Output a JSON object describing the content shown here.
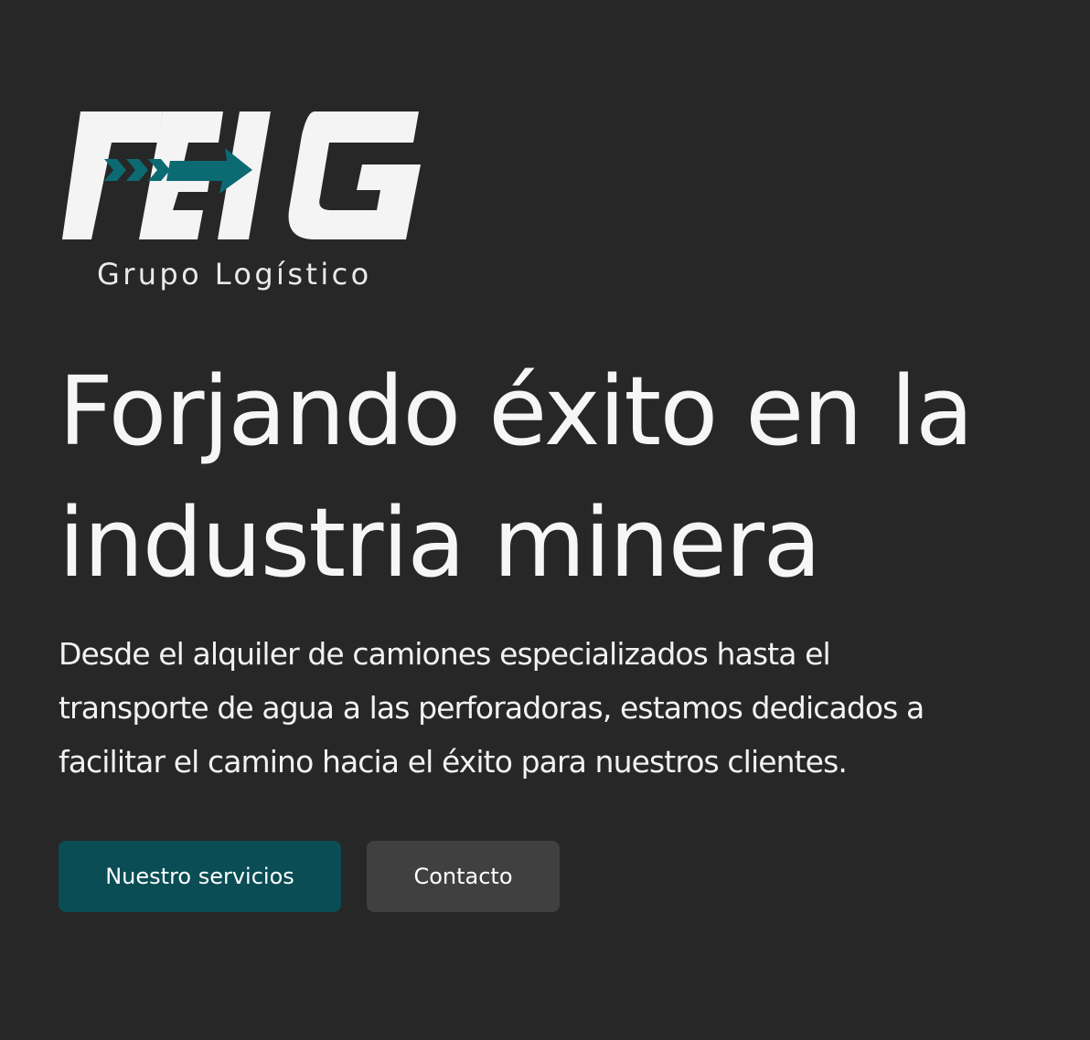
{
  "brand": {
    "logo_text": "FEIG",
    "tagline": "Grupo Logístico",
    "accent_color": "#0c6a72",
    "logo_color": "#f4f4f4"
  },
  "hero": {
    "title_lines": [
      "Forjando éxito en la",
      "industria minera"
    ],
    "description_lines": [
      "Desde el alquiler de camiones especializados hasta el",
      "transporte de agua a las perforadoras, estamos dedicados a",
      "facilitar el camino hacia el éxito para nuestros clientes."
    ]
  },
  "buttons": {
    "services_label": "Nuestro servicios",
    "contact_label": "Contacto",
    "primary_color": "#0a4d55",
    "secondary_color": "#404040"
  },
  "colors": {
    "background": "#272727",
    "text": "#f5f5f5"
  }
}
